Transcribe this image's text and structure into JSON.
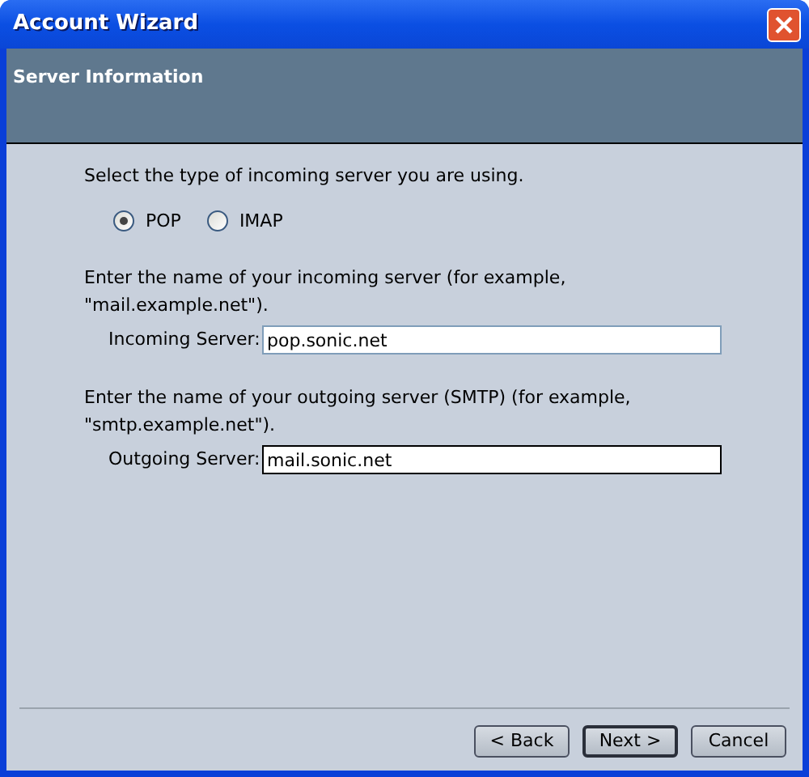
{
  "window": {
    "title": "Account Wizard"
  },
  "header": {
    "title": "Server Information"
  },
  "server_type": {
    "prompt": "Select the type of incoming server you are using.",
    "options": [
      {
        "label": "POP",
        "selected": true
      },
      {
        "label": "IMAP",
        "selected": false
      }
    ]
  },
  "sections": [
    {
      "prompt": "Enter the name of your incoming server (for example, \"mail.example.net\").",
      "label": "Incoming Server:",
      "value": "pop.sonic.net",
      "focused": false
    },
    {
      "prompt": "Enter the name of your outgoing server (SMTP) (for example, \"smtp.example.net\").",
      "label": "Outgoing Server:",
      "value": "mail.sonic.net",
      "focused": true
    }
  ],
  "buttons": [
    {
      "label": "< Back",
      "default": false
    },
    {
      "label": "Next >",
      "default": true
    },
    {
      "label": "Cancel",
      "default": false
    }
  ]
}
